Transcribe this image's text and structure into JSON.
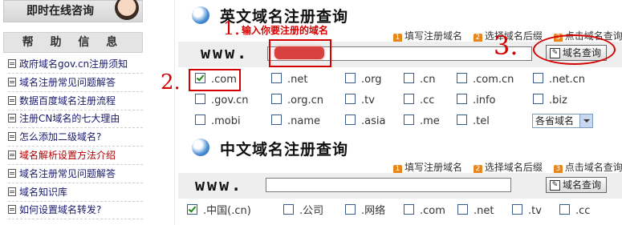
{
  "sidebar": {
    "online_label": "即时在线咨询",
    "help_title": "帮 助 信 息",
    "items": [
      {
        "label": "政府域名gov.cn注册须知"
      },
      {
        "label": "域名注册常见问题解答"
      },
      {
        "label": "数据百度域名注册流程"
      },
      {
        "label": "注册CN域名的七大理由"
      },
      {
        "label": "怎么添加二级域名?"
      },
      {
        "label": "域名解析设置方法介绍"
      },
      {
        "label": "域名注册常见问题解答"
      },
      {
        "label": "域名知识库"
      },
      {
        "label": "如何设置域名转发?"
      }
    ]
  },
  "english": {
    "title": "英文域名注册查询",
    "steps": [
      {
        "num": "1",
        "label": "填写注册域名"
      },
      {
        "num": "2",
        "label": "选择域名后缀"
      },
      {
        "num": "3",
        "label": "点击域名查询"
      }
    ],
    "www": "www.",
    "input_value": "",
    "query_button": "域名查询",
    "tlds": [
      ".com",
      ".net",
      ".org",
      ".cn",
      ".com.cn",
      ".net.cn",
      ".gov.cn",
      ".org.cn",
      ".tv",
      ".cc",
      ".info",
      ".biz",
      ".mobi",
      ".name",
      ".asia",
      ".me",
      ".tel"
    ],
    "checked": [
      ".com"
    ],
    "province_select": "各省域名"
  },
  "chinese": {
    "title": "中文域名注册查询",
    "steps": [
      {
        "num": "1",
        "label": "填写注册域名"
      },
      {
        "num": "2",
        "label": "选择域名后缀"
      },
      {
        "num": "3",
        "label": "点击域名查询"
      }
    ],
    "www": "www.",
    "input_value": "",
    "query_button": "域名查询",
    "tlds": [
      ".中国(.cn)",
      ".公司",
      ".网络",
      ".com",
      ".net",
      ".tv",
      ".cc"
    ],
    "checked": [
      ".中国(.cn)"
    ]
  },
  "annotations": {
    "step1": "1.",
    "step1_note": "输入你要注册的域名",
    "step2": "2.",
    "step3": "3."
  },
  "colors": {
    "annotation": "#d40000",
    "step_badge": "#e8861a",
    "bar": "#eeeeee"
  }
}
